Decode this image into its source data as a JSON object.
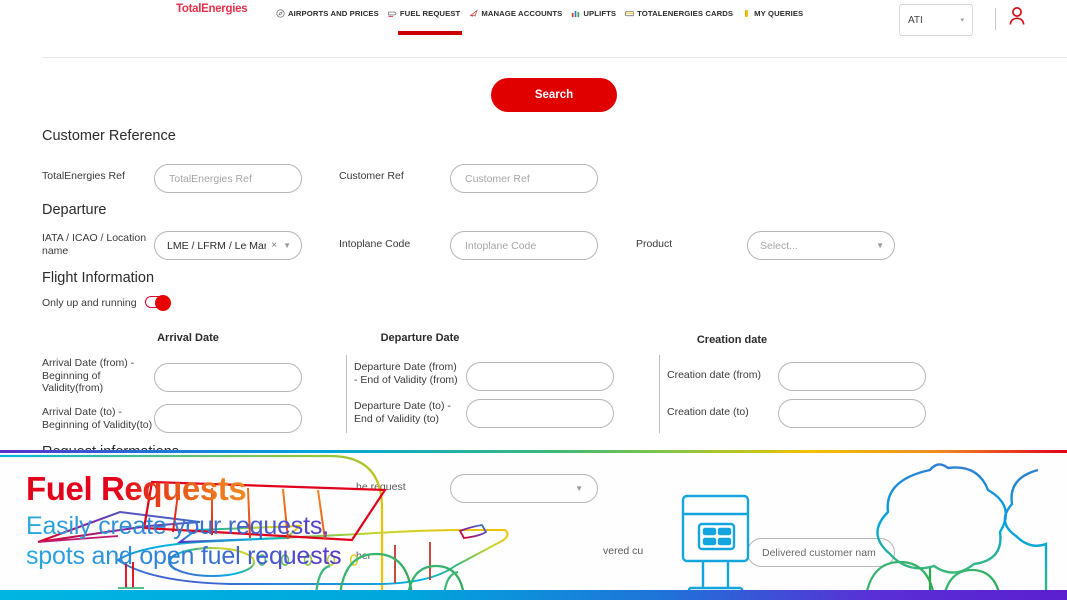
{
  "header": {
    "logo": "TotalEnergies",
    "nav": [
      {
        "label": "AIRPORTS AND PRICES",
        "icon": "compass-icon",
        "active": false
      },
      {
        "label": "FUEL REQUEST",
        "icon": "fuel-request-icon",
        "active": true
      },
      {
        "label": "MANAGE ACCOUNTS",
        "icon": "manage-accounts-icon",
        "active": false
      },
      {
        "label": "UPLIFTS",
        "icon": "bar-chart-icon",
        "active": false
      },
      {
        "label": "TOTALENERGIES CARDS",
        "icon": "card-icon",
        "active": false
      },
      {
        "label": "MY QUERIES",
        "icon": "queries-icon",
        "active": false
      }
    ],
    "account": {
      "value": "ATI",
      "caret": "▾"
    },
    "user_icon": "user-account-icon"
  },
  "search": {
    "label": "Search"
  },
  "customer_reference": {
    "title": "Customer Reference",
    "totalenergies_ref": {
      "label": "TotalEnergies Ref",
      "placeholder": "TotalEnergies Ref",
      "value": ""
    },
    "customer_ref": {
      "label": "Customer Ref",
      "placeholder": "Customer Ref",
      "value": ""
    }
  },
  "departure": {
    "title": "Departure",
    "iata": {
      "label": "IATA / ICAO / Location name",
      "value": "LME / LFRM / Le Man…",
      "clear": "×",
      "caret": "▼"
    },
    "intoplane": {
      "label": "Intoplane Code",
      "placeholder": "Intoplane Code",
      "value": ""
    },
    "product": {
      "label": "Product",
      "placeholder": "Select...",
      "value": "",
      "caret": "▼"
    }
  },
  "flight_information": {
    "title": "Flight Information",
    "only_up_and_running": {
      "label": "Only up and running",
      "state": "on"
    },
    "columns": [
      {
        "heading": "Arrival Date",
        "rows": [
          {
            "label": "Arrival Date (from) - Beginning of Validity(from)",
            "value": ""
          },
          {
            "label": "Arrival Date (to) - Beginning of Validity(to)",
            "value": ""
          }
        ]
      },
      {
        "heading": "Departure Date",
        "rows": [
          {
            "label": "Departure Date (from) - End of Validity (from)",
            "value": ""
          },
          {
            "label": "Departure Date (to) - End of Validity (to)",
            "value": ""
          }
        ]
      },
      {
        "heading": "Creation date",
        "rows": [
          {
            "label": "Creation date (from)",
            "value": ""
          },
          {
            "label": "Creation date (to)",
            "value": ""
          }
        ]
      }
    ]
  },
  "request_informations": {
    "title": "Request informations",
    "status_label_partial": "he request",
    "flight_number_label_partial": "ber",
    "delivered_customer_partial": "vered cu",
    "delivered_customer": {
      "placeholder": "Delivered customer nam",
      "value": ""
    },
    "status_caret": "▼"
  },
  "banner": {
    "title": "Fuel Requests",
    "subtitle_line1": "Easily create your requests,",
    "subtitle_line2": "spots and open fuel requests",
    "illustration": "airplane-fuel-pump-trees-illustration"
  },
  "colors": {
    "brand_red": "#e2001a",
    "button_red": "#e00000",
    "nav_underline": "#cc0000",
    "toggle_on": "#e80000",
    "banner_blue": "#29a8e0",
    "banner_purple": "#5b35c6"
  }
}
